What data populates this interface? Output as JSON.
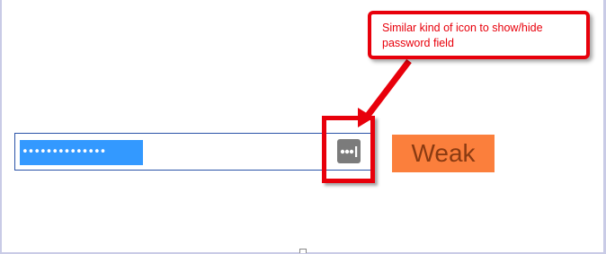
{
  "password_field": {
    "masked_value": "••••••••••••••",
    "selected": true
  },
  "reveal_icon": {
    "icon": "password-reveal-icon",
    "glyph": "•••|"
  },
  "strength_badge": {
    "label": "Weak",
    "color": "#fb7f3c"
  },
  "annotation": {
    "callout_text": "Similar kind of icon to show/hide password field",
    "accent_color": "#e8000b"
  }
}
